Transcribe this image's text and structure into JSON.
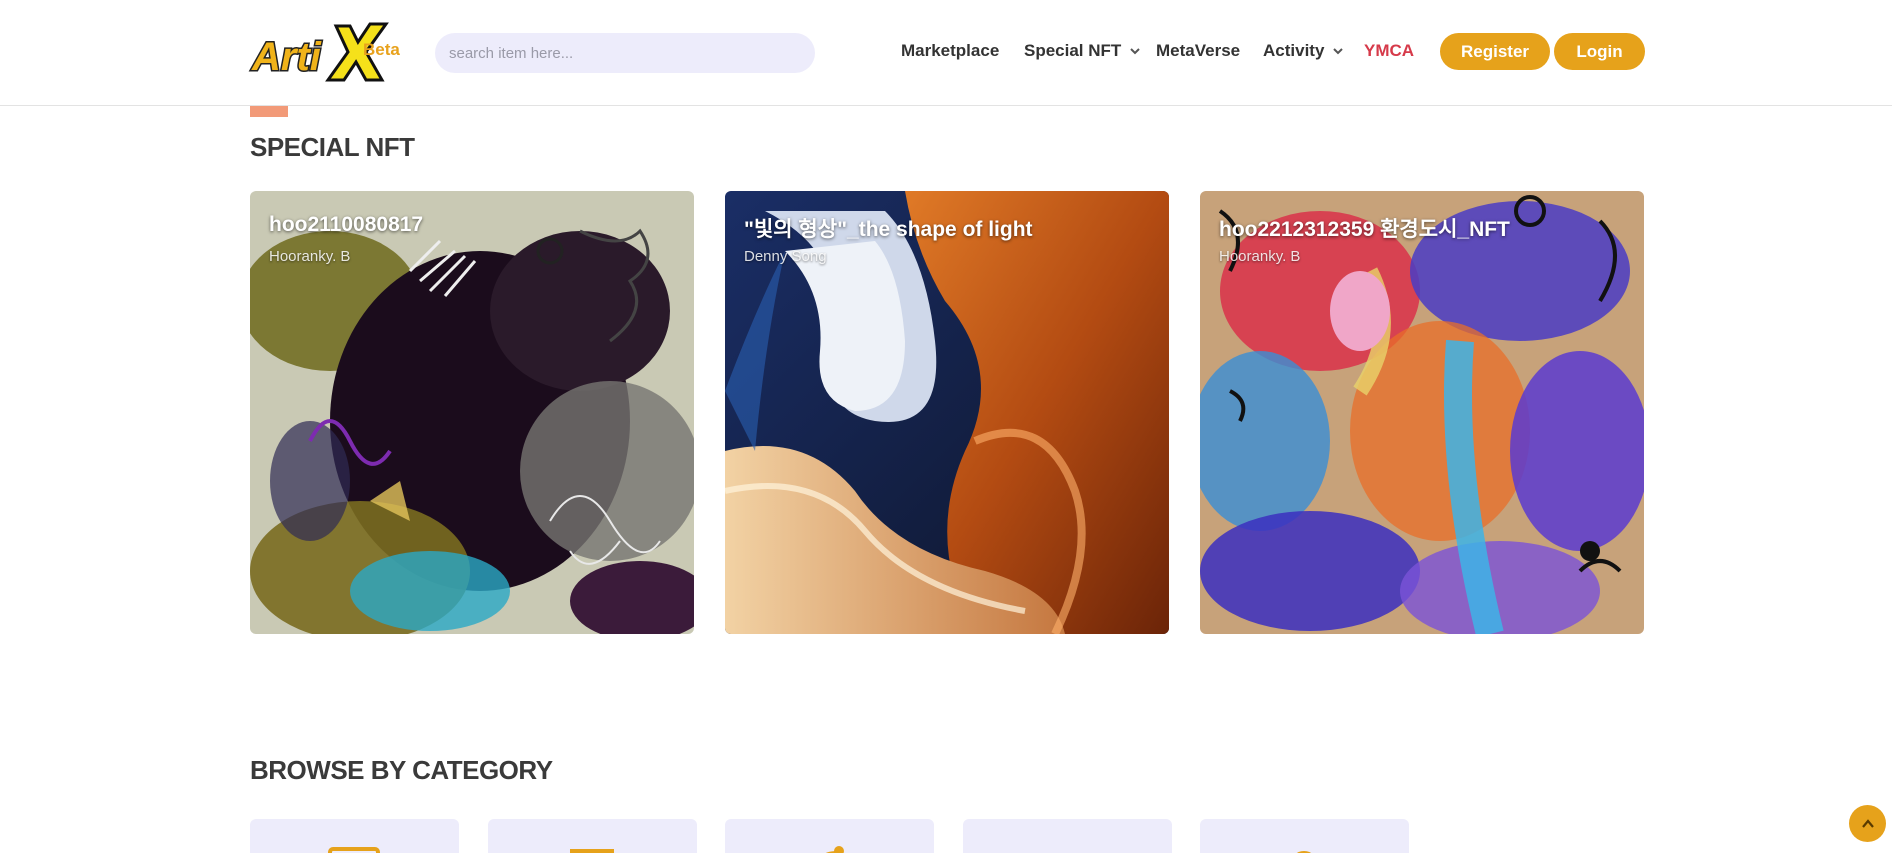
{
  "header": {
    "logo_text": "ArtiX",
    "beta_label": "Beta",
    "search_placeholder": "search item here...",
    "nav": [
      {
        "label": "Marketplace",
        "dropdown": false
      },
      {
        "label": "Special NFT",
        "dropdown": true
      },
      {
        "label": "MetaVerse",
        "dropdown": false
      },
      {
        "label": "Activity",
        "dropdown": true
      },
      {
        "label": "YMCA",
        "dropdown": false
      }
    ],
    "register_label": "Register",
    "login_label": "Login"
  },
  "special_nft": {
    "title": "SPECIAL NFT",
    "cards": [
      {
        "title": "hoo2110080817",
        "author": "Hooranky. B"
      },
      {
        "title": "\"빛의 형상\"_the shape of light",
        "author": "Denny Song"
      },
      {
        "title": "hoo2212312359 환경도시_NFT",
        "author": "Hooranky. B"
      }
    ]
  },
  "browse": {
    "title": "BROWSE BY CATEGORY"
  },
  "colors": {
    "accent": "#e6a21b",
    "ymca": "#d63a4a",
    "search_bg": "#edecfb",
    "section_accent": "#f29a78"
  },
  "icons": {
    "scroll_top": "chevron-up-icon"
  }
}
